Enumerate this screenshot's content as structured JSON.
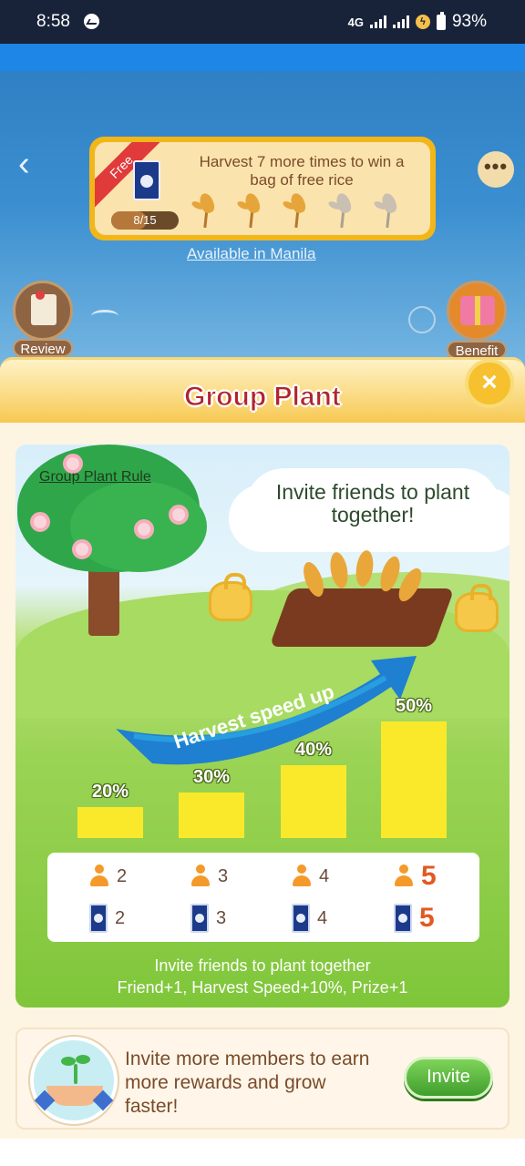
{
  "status_bar": {
    "time": "8:58",
    "network": "4G",
    "battery": "93%"
  },
  "header": {
    "more_label": "•••"
  },
  "promo": {
    "badge": "Free",
    "progress_text": "8/15",
    "progress": 0.533,
    "message": "Harvest 7 more times to win a bag of free rice",
    "harvest_icons": [
      "wheat-filled",
      "wheat-filled",
      "wheat-filled",
      "wheat-empty",
      "wheat-empty"
    ]
  },
  "availability": "Available in Manila",
  "side_buttons": {
    "review": "Review",
    "benefit": "Benefit"
  },
  "panel": {
    "title": "Group Plant",
    "close_label": "×",
    "rule_link": "Group Plant Rule",
    "cloud_text": "Invite friends to plant together!",
    "arrow_label": "Harvest speed up",
    "bars": [
      {
        "percent": "20%",
        "value": 20
      },
      {
        "percent": "30%",
        "value": 30
      },
      {
        "percent": "40%",
        "value": 40
      },
      {
        "percent": "50%",
        "value": 50
      }
    ],
    "members": [
      "2",
      "3",
      "4",
      "5"
    ],
    "prizes": [
      "2",
      "3",
      "4",
      "5"
    ],
    "caption_line1": "Invite friends to plant together",
    "caption_line2": "Friend+1, Harvest Speed+10%, Prize+1"
  },
  "invite": {
    "message": "Invite more members to earn more rewards and grow faster!",
    "button": "Invite"
  },
  "colors": {
    "accent_green": "#3f9e2c",
    "title_red": "#b0242e",
    "bar_yellow": "#f9e92a",
    "highlight_orange": "#e05a22"
  }
}
